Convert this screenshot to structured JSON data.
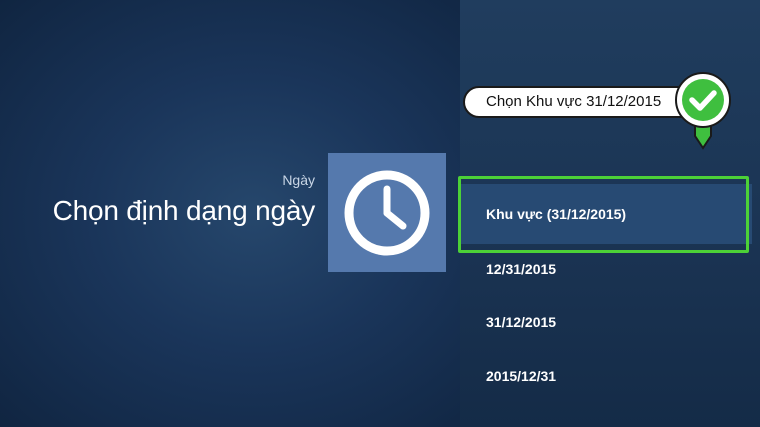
{
  "screen": {
    "category": "Ngày",
    "heading": "Chọn định dạng ngày"
  },
  "options": [
    {
      "label": "Khu vực (31/12/2015)",
      "selected": true
    },
    {
      "label": "12/31/2015",
      "selected": false
    },
    {
      "label": "31/12/2015",
      "selected": false
    },
    {
      "label": "2015/12/31",
      "selected": false
    }
  ],
  "callout": {
    "text": "Chọn Khu vực 31/12/2015"
  },
  "icons": {
    "tile": "clock-icon",
    "annotation": "checkmark-icon"
  },
  "colors": {
    "highlight": "#4cd137",
    "tile": "#5579ad"
  }
}
